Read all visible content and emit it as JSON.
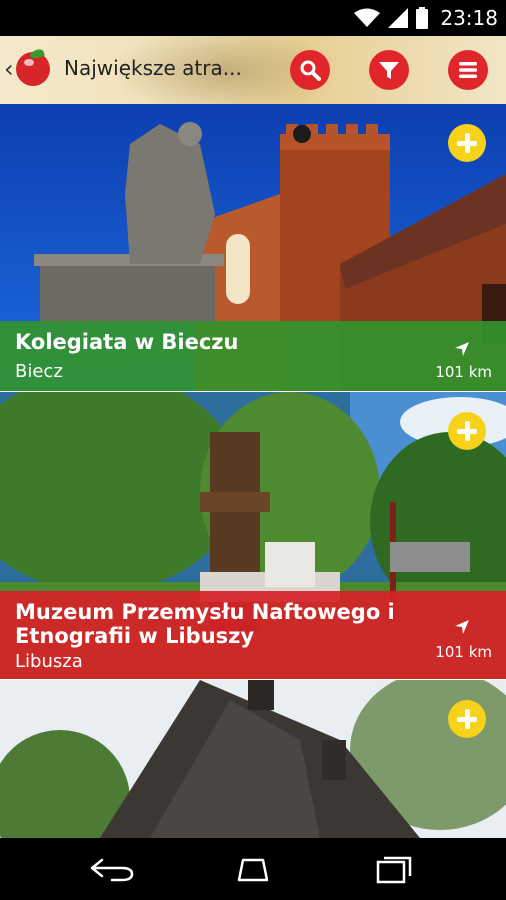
{
  "status_bar": {
    "time": "23:18",
    "icons": [
      "wifi-icon",
      "signal-icon",
      "battery-icon"
    ]
  },
  "app_bar": {
    "title": "Największe atra...",
    "buttons": [
      "search-icon",
      "filter-icon",
      "menu-icon"
    ],
    "accent_color": "#e1262b"
  },
  "attractions": [
    {
      "name": "Kolegiata w Bieczu",
      "town": "Biecz",
      "distance": "101 km",
      "caption_color": "#33942d"
    },
    {
      "name": "Muzeum Przemysłu Naftowego i Etnografii w Libuszy",
      "town": "Libusza",
      "distance": "101 km",
      "caption_color": "#d62228"
    },
    {
      "name": "",
      "town": "",
      "distance": ""
    }
  ],
  "add_button_color": "#f7d21b",
  "nav_bar": {
    "buttons": [
      "back-icon",
      "home-icon",
      "recents-icon"
    ]
  }
}
